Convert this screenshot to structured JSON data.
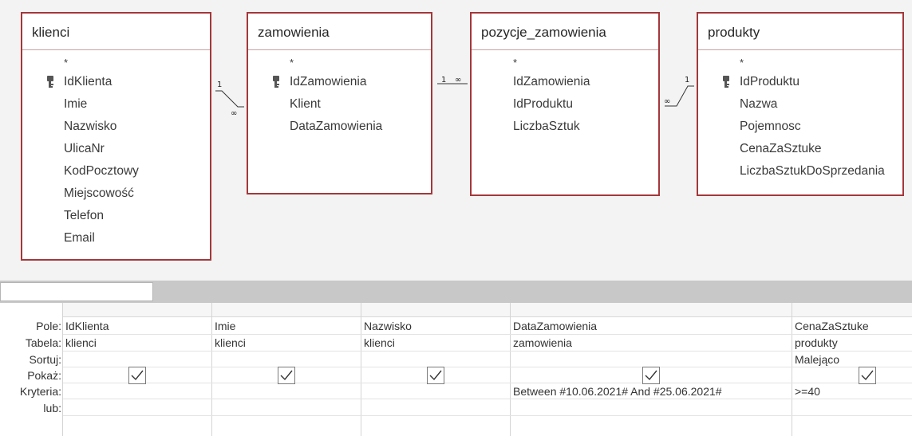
{
  "diagram": {
    "tables": [
      {
        "name": "klienci",
        "fields": [
          "*",
          "IdKlienta",
          "Imie",
          "Nazwisko",
          "UlicaNr",
          "KodPocztowy",
          "Miejscowość",
          "Telefon",
          "Email"
        ],
        "key_field": "IdKlienta"
      },
      {
        "name": "zamowienia",
        "fields": [
          "*",
          "IdZamowienia",
          "Klient",
          "DataZamowienia"
        ],
        "key_field": "IdZamowienia"
      },
      {
        "name": "pozycje_zamowienia",
        "fields": [
          "*",
          "IdZamowienia",
          "IdProduktu",
          "LiczbaSztuk"
        ],
        "key_field": ""
      },
      {
        "name": "produkty",
        "fields": [
          "*",
          "IdProduktu",
          "Nazwa",
          "Pojemnosc",
          "CenaZaSztuke",
          "LiczbaSztukDoSprzedania"
        ],
        "key_field": "IdProduktu"
      }
    ],
    "relations": [
      {
        "one": "1",
        "many": "∞"
      },
      {
        "one": "1",
        "many": "∞"
      },
      {
        "one": "1",
        "many": "∞"
      }
    ],
    "border_color": "#a4373a"
  },
  "grid": {
    "row_labels": {
      "pole": "Pole:",
      "tabela": "Tabela:",
      "sortuj": "Sortuj:",
      "pokaz": "Pokaż:",
      "kryteria": "Kryteria:",
      "lub": "lub:"
    },
    "columns": [
      {
        "pole": "IdKlienta",
        "tabela": "klienci",
        "sortuj": "",
        "pokaz": true,
        "kryteria": "",
        "lub": ""
      },
      {
        "pole": "Imie",
        "tabela": "klienci",
        "sortuj": "",
        "pokaz": true,
        "kryteria": "",
        "lub": ""
      },
      {
        "pole": "Nazwisko",
        "tabela": "klienci",
        "sortuj": "",
        "pokaz": true,
        "kryteria": "",
        "lub": ""
      },
      {
        "pole": "DataZamowienia",
        "tabela": "zamowienia",
        "sortuj": "",
        "pokaz": true,
        "kryteria": "Between #10.06.2021# And #25.06.2021#",
        "lub": ""
      },
      {
        "pole": "CenaZaSztuke",
        "tabela": "produkty",
        "sortuj": "Malejąco",
        "pokaz": true,
        "kryteria": ">=40",
        "lub": ""
      }
    ]
  }
}
